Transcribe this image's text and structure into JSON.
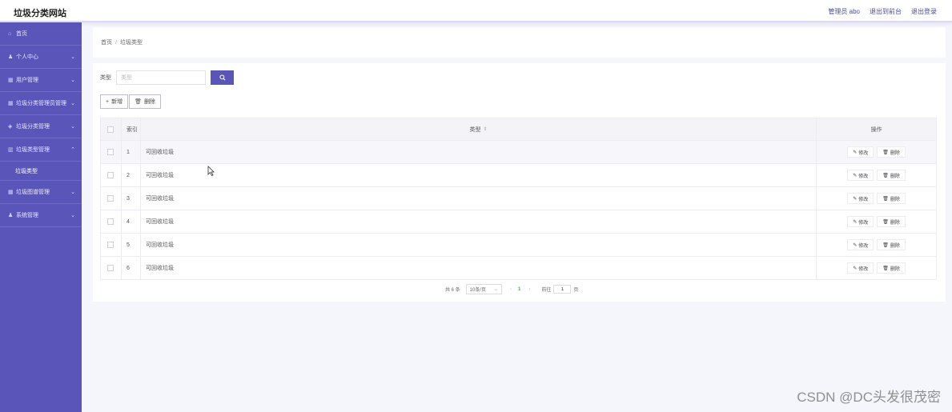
{
  "header": {
    "title": "垃圾分类网站",
    "links": [
      "管理员 abo",
      "退出到前台",
      "退出登录"
    ]
  },
  "sidebar": {
    "items": [
      {
        "label": "首页",
        "icon": "home-icon"
      },
      {
        "label": "个人中心",
        "icon": "user-icon"
      },
      {
        "label": "用户管理",
        "icon": "grid-icon"
      },
      {
        "label": "垃圾分类管理员管理",
        "icon": "grid-icon"
      },
      {
        "label": "垃圾分类管理",
        "icon": "shield-icon"
      },
      {
        "label": "垃圾类型管理",
        "icon": "chart-icon",
        "expanded": true,
        "children": [
          "垃圾类型"
        ]
      },
      {
        "label": "垃圾图谱管理",
        "icon": "grid-icon"
      },
      {
        "label": "系统管理",
        "icon": "user-icon"
      }
    ]
  },
  "breadcrumb": {
    "home": "首页",
    "separator": "/",
    "current": "垃圾类型"
  },
  "search": {
    "label": "类型",
    "placeholder": "类型"
  },
  "actions": {
    "add": "新增",
    "delete": "删除"
  },
  "table": {
    "columns": {
      "index": "索引",
      "type": "类型",
      "operation": "操作"
    },
    "rows": [
      {
        "index": "1",
        "type": "可回收垃圾"
      },
      {
        "index": "2",
        "type": "可回收垃圾"
      },
      {
        "index": "3",
        "type": "可回收垃圾"
      },
      {
        "index": "4",
        "type": "可回收垃圾"
      },
      {
        "index": "5",
        "type": "可回收垃圾"
      },
      {
        "index": "6",
        "type": "可回收垃圾"
      }
    ],
    "row_actions": {
      "edit": "修改",
      "delete": "删除"
    }
  },
  "pagination": {
    "total": "共 6 条",
    "page_size": "10条/页",
    "current_page": "1",
    "goto_label": "前往",
    "goto_value": "1",
    "page_suffix": "页"
  },
  "watermark": "CSDN @DC头发很茂密",
  "colors": {
    "accent": "#5a55b8",
    "sidebar": "#5a55b8",
    "page": "#f5f6fb"
  }
}
